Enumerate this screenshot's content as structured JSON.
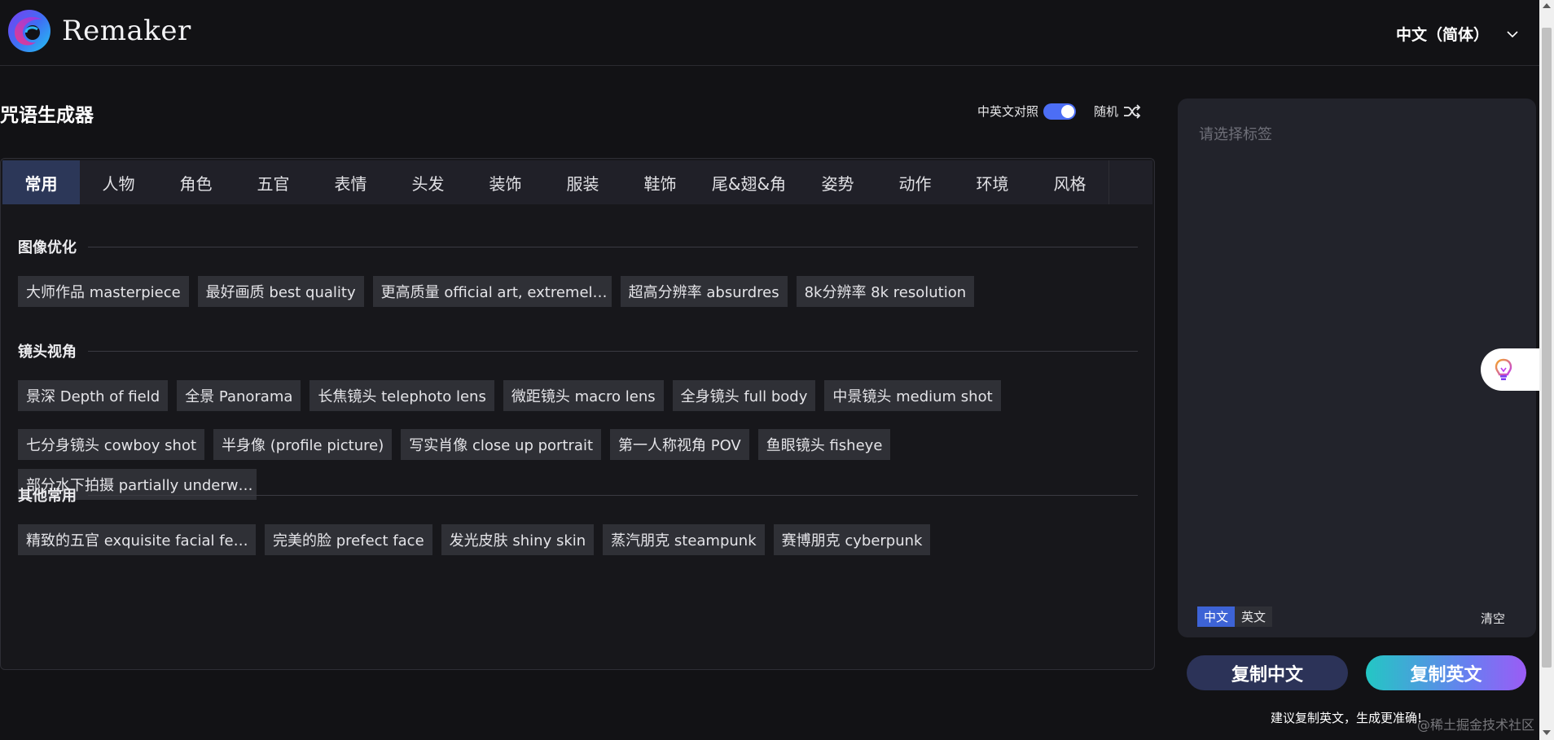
{
  "header": {
    "brand": "Remaker",
    "language": "中文（简体）"
  },
  "generator": {
    "title": "咒语生成器",
    "bilingual_label": "中英文对照",
    "bilingual_on": true,
    "random_label": "随机"
  },
  "tabs": [
    {
      "label": "常用",
      "active": true
    },
    {
      "label": "人物"
    },
    {
      "label": "角色"
    },
    {
      "label": "五官"
    },
    {
      "label": "表情"
    },
    {
      "label": "头发"
    },
    {
      "label": "装饰"
    },
    {
      "label": "服装"
    },
    {
      "label": "鞋饰"
    },
    {
      "label": "尾&翅&角"
    },
    {
      "label": "姿势"
    },
    {
      "label": "动作"
    },
    {
      "label": "环境"
    },
    {
      "label": "风格"
    }
  ],
  "sections": [
    {
      "title": "图像优化",
      "tags": [
        "大师作品 masterpiece",
        "最好画质 best quality",
        "更高质量 official art, extremel…",
        "超高分辨率 absurdres",
        "8k分辨率 8k resolution"
      ]
    },
    {
      "title": "镜头视角",
      "tags": [
        "景深 Depth of field",
        "全景 Panorama",
        "长焦镜头 telephoto lens",
        "微距镜头 macro lens",
        "全身镜头 full body",
        "中景镜头 medium shot",
        "七分身镜头 cowboy shot",
        "半身像 (profile picture)",
        "写实肖像 close up portrait",
        "第一人称视角 POV",
        "鱼眼镜头 fisheye",
        "部分水下拍摄 partially underw…"
      ]
    },
    {
      "title": "其他常用",
      "tags": [
        "精致的五官 exquisite facial fe…",
        "完美的脸 prefect face",
        "发光皮肤 shiny skin",
        "蒸汽朋克 steampunk",
        "赛博朋克 cyberpunk"
      ]
    }
  ],
  "editor": {
    "placeholder": "请选择标签",
    "lang_cn": "中文",
    "lang_en": "英文",
    "clear": "清空"
  },
  "actions": {
    "copy_cn": "复制中文",
    "copy_en": "复制英文",
    "tip": "建议复制英文，生成更准确!"
  },
  "watermark": "@稀土掘金技术社区"
}
